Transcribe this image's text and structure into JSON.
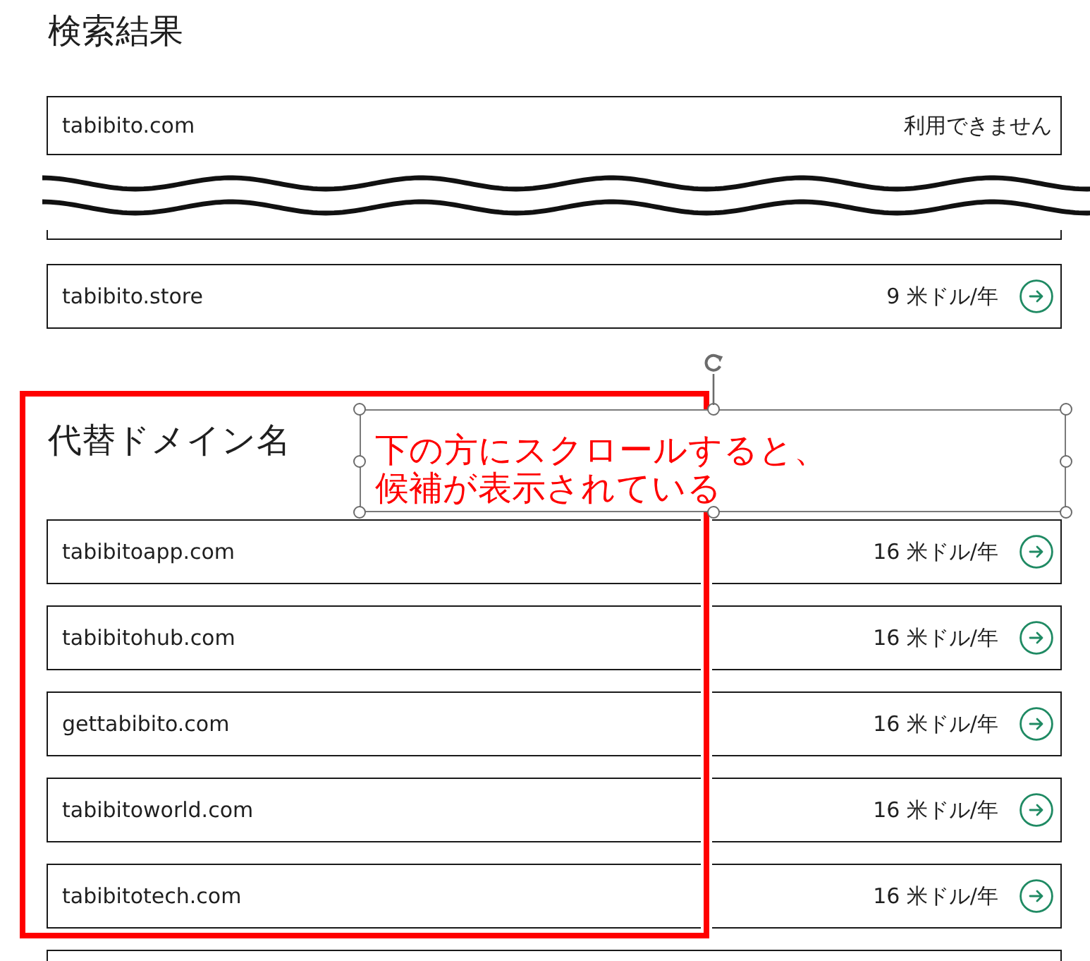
{
  "search_results": {
    "title": "検索結果",
    "rows": [
      {
        "kind": "unavailable",
        "domain": "tabibito.com",
        "status": "利用できません"
      },
      {
        "kind": "break"
      },
      {
        "kind": "available",
        "domain": "tabibito.store",
        "price": "9 米ドル/年"
      }
    ]
  },
  "alternative_domains": {
    "title": "代替ドメイン名",
    "rows": [
      {
        "kind": "available",
        "domain": "tabibitoapp.com",
        "price": "16 米ドル/年"
      },
      {
        "kind": "available",
        "domain": "tabibitohub.com",
        "price": "16 米ドル/年"
      },
      {
        "kind": "available",
        "domain": "gettabibito.com",
        "price": "16 米ドル/年"
      },
      {
        "kind": "available",
        "domain": "tabibitoworld.com",
        "price": "16 米ドル/年"
      },
      {
        "kind": "available",
        "domain": "tabibitotech.com",
        "price": "16 米ドル/年"
      },
      {
        "kind": "cut_off"
      }
    ]
  },
  "annotations": [
    {
      "kind": "highlight_frame"
    },
    {
      "kind": "text_box",
      "text": "下の方にスクロールすると、候補が表示されている",
      "selected": true
    }
  ]
}
